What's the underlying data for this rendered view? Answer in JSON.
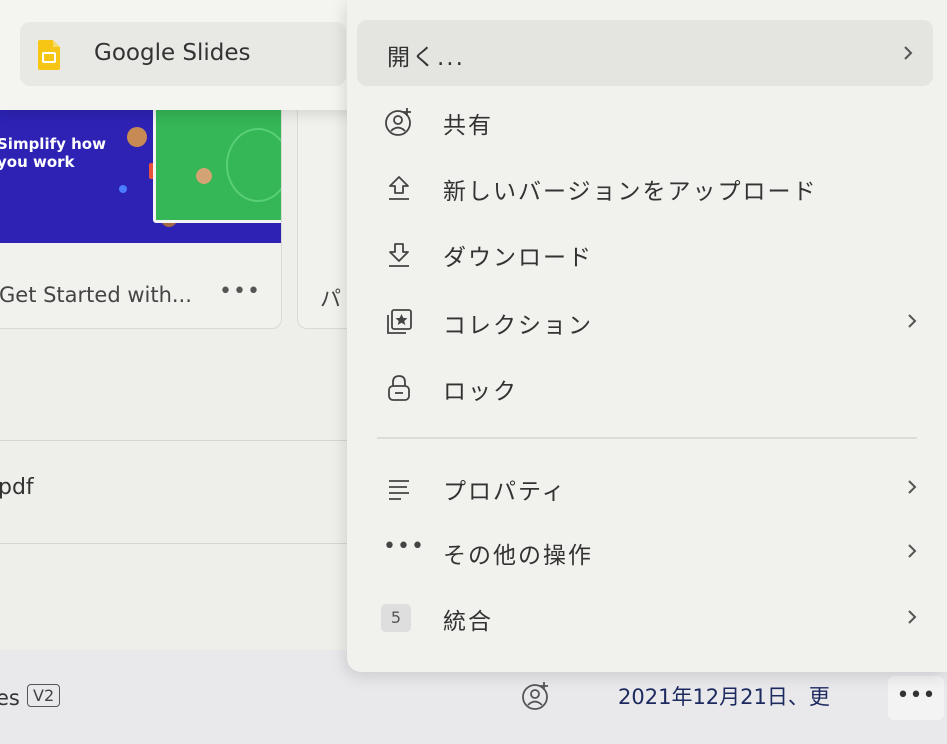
{
  "open_with": {
    "app_label": "Google Slides",
    "app_icon": "google-slides-icon",
    "app_color": "#f7c514"
  },
  "background": {
    "card1": {
      "thumbnail_headline": "Simplify how you work",
      "caption": "Get Started with...",
      "more": "•••"
    },
    "card2": {
      "caption": "パ"
    },
    "list_item": "pdf",
    "bottom_bar": {
      "file_name": "es",
      "version_badge": "V2",
      "date": "2021年12月21日、更",
      "more": "•••"
    }
  },
  "menu": {
    "open": {
      "label": "開く...",
      "has_submenu": true
    },
    "share": {
      "label": "共有",
      "icon": "share-user-icon"
    },
    "upload_version": {
      "label": "新しいバージョンをアップロード",
      "icon": "upload-icon"
    },
    "download": {
      "label": "ダウンロード",
      "icon": "download-icon"
    },
    "collection": {
      "label": "コレクション",
      "icon": "collection-star-icon",
      "has_submenu": true
    },
    "lock": {
      "label": "ロック",
      "icon": "lock-icon"
    },
    "properties": {
      "label": "プロパティ",
      "icon": "lines-icon",
      "has_submenu": true
    },
    "more_actions": {
      "label": "その他の操作",
      "icon": "dots-icon",
      "has_submenu": true
    },
    "integrations": {
      "label": "統合",
      "count": "5",
      "has_submenu": true
    }
  },
  "colors": {
    "menu_bg": "#f1f1ed",
    "highlight": "#e4e4e0",
    "thumbnail_blue": "#2d22b4",
    "thumbnail_green": "#35b657",
    "date_text": "#1d2a60"
  }
}
